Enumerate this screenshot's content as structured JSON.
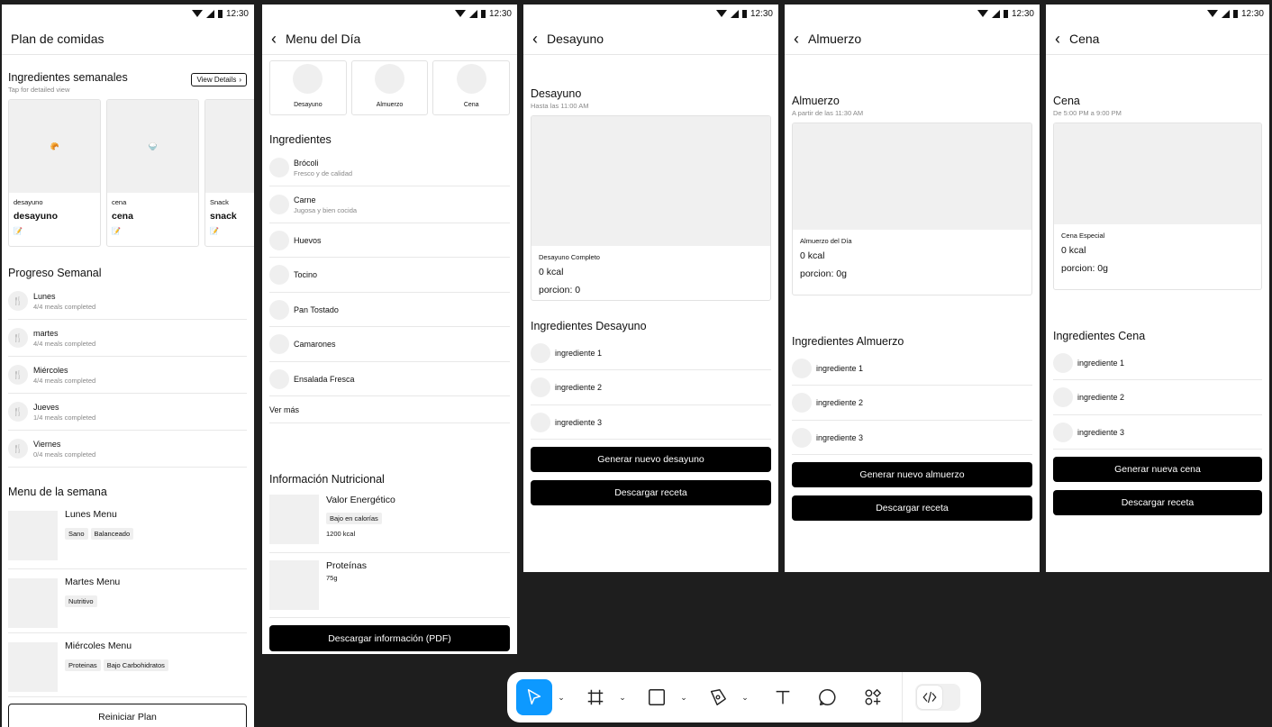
{
  "status": {
    "time": "12:30"
  },
  "plan": {
    "title": "Plan de comidas",
    "weekly_ingredients_title": "Ingredientes semanales",
    "weekly_ingredients_subtitle": "Tap for detailed view",
    "view_details_label": "View Details",
    "cards": [
      {
        "small": "desayuno",
        "big": "desayuno",
        "emoji": "🥐"
      },
      {
        "small": "cena",
        "big": "cena",
        "emoji": "🍚"
      },
      {
        "small": "Snack",
        "big": "snack",
        "emoji": "🥪"
      }
    ],
    "card_note_emoji": "📝",
    "progress_title": "Progreso Semanal",
    "progress": [
      {
        "day": "Lunes",
        "status": "4/4 meals completed"
      },
      {
        "day": "martes",
        "status": "4/4 meals completed"
      },
      {
        "day": "Miércoles",
        "status": "4/4 meals completed"
      },
      {
        "day": "Jueves",
        "status": "1/4 meals completed"
      },
      {
        "day": "Viernes",
        "status": "0/4 meals completed"
      }
    ],
    "week_menu_title": "Menu de la semana",
    "week_menus": [
      {
        "name": "Lunes Menu",
        "tags": [
          "Sano",
          "Balanceado"
        ]
      },
      {
        "name": "Martes Menu",
        "tags": [
          "Nutritivo"
        ]
      },
      {
        "name": "Miércoles Menu",
        "tags": [
          "Proteinas",
          "Bajo Carbohidratos"
        ]
      }
    ],
    "reset_label": "Reiniciar Plan"
  },
  "menu": {
    "title": "Menu del Día",
    "meals": [
      "Desayuno",
      "Almuerzo",
      "Cena"
    ],
    "ingredients_title": "Ingredientes",
    "ingredients": [
      {
        "name": "Brócoli",
        "desc": "Fresco y de calidad"
      },
      {
        "name": "Carne",
        "desc": "Jugosa y bien cocida"
      },
      {
        "name": "Huevos",
        "desc": ""
      },
      {
        "name": "Tocino",
        "desc": ""
      },
      {
        "name": "Pan Tostado",
        "desc": ""
      },
      {
        "name": "Camarones",
        "desc": ""
      },
      {
        "name": "Ensalada Fresca",
        "desc": ""
      }
    ],
    "see_more": "Ver más",
    "nutrition_title": "Información Nutricional",
    "nutrition": [
      {
        "name": "Valor Energético",
        "tag": "Bajo en calorías",
        "value": "1200 kcal"
      },
      {
        "name": "Proteínas",
        "tag": "",
        "value": "75g"
      }
    ],
    "download_label": "Descargar información (PDF)"
  },
  "meals": [
    {
      "title": "Desayuno",
      "heading": "Desayuno",
      "subtitle": "Hasta las 11:00 AM",
      "card_label": "Desayuno Completo",
      "kcal": "0 kcal",
      "portion": "porcion: 0",
      "ingredients_title": "Ingredientes Desayuno",
      "ingredients": [
        "ingrediente 1",
        "ingrediente 2",
        "ingrediente 3"
      ],
      "generate_label": "Generar nuevo desayuno",
      "download_label": "Descargar receta"
    },
    {
      "title": "Almuerzo",
      "heading": "Almuerzo",
      "subtitle": "A partir de las 11:30 AM",
      "card_label": "Almuerzo del Día",
      "kcal": "0 kcal",
      "portion": "porcion: 0g",
      "ingredients_title": "Ingredientes Almuerzo",
      "ingredients": [
        "ingrediente 1",
        "ingrediente 2",
        "ingrediente 3"
      ],
      "generate_label": "Generar nuevo almuerzo",
      "download_label": "Descargar receta"
    },
    {
      "title": "Cena",
      "heading": "Cena",
      "subtitle": "De 5:00 PM a 9:00 PM",
      "card_label": "Cena Especial",
      "kcal": "0 kcal",
      "portion": "porcion: 0g",
      "ingredients_title": "Ingredientes Cena",
      "ingredients": [
        "ingrediente 1",
        "ingrediente 2",
        "ingrediente 3"
      ],
      "generate_label": "Generar nueva cena",
      "download_label": "Descargar receta"
    }
  ],
  "toolbar": {
    "tools": [
      "move-tool",
      "frame-tool",
      "shape-tool",
      "pen-tool",
      "text-tool",
      "comment-tool",
      "components-tool",
      "dev-mode-toggle"
    ],
    "accent": "#0d99ff"
  }
}
